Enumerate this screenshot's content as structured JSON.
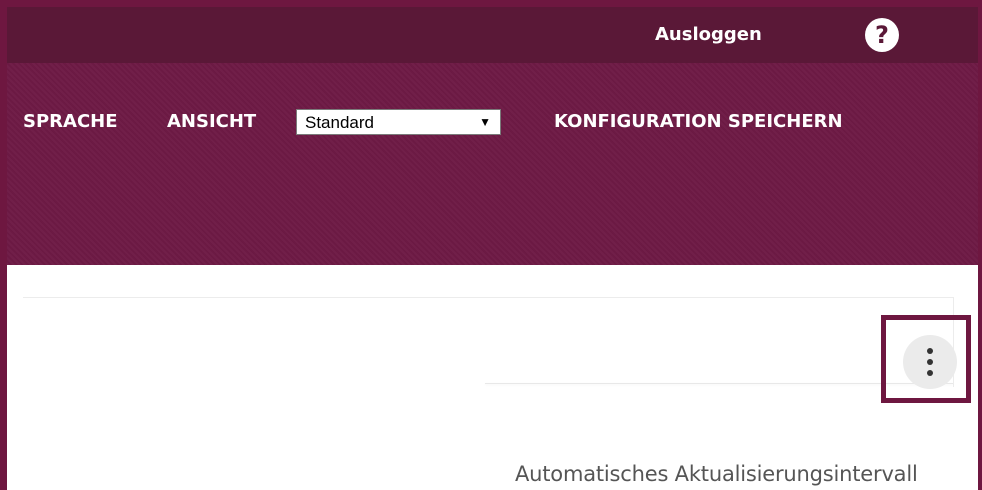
{
  "header": {
    "logout_label": "Ausloggen",
    "help_label": "?"
  },
  "nav": {
    "language_label": "SPRACHE",
    "view_label": "ANSICHT",
    "view_select": {
      "selected": "Standard",
      "arrow": "▼"
    },
    "save_config_label": "KONFIGURATION SPEICHERN"
  },
  "content": {
    "auto_refresh_label": "Automatisches Aktualisierungsintervall",
    "more_menu_icon": "vertical-ellipsis-icon"
  },
  "colors": {
    "topbar": "#5a1837",
    "mainbar": "#6e1a45",
    "accent_border": "#6e1740"
  }
}
